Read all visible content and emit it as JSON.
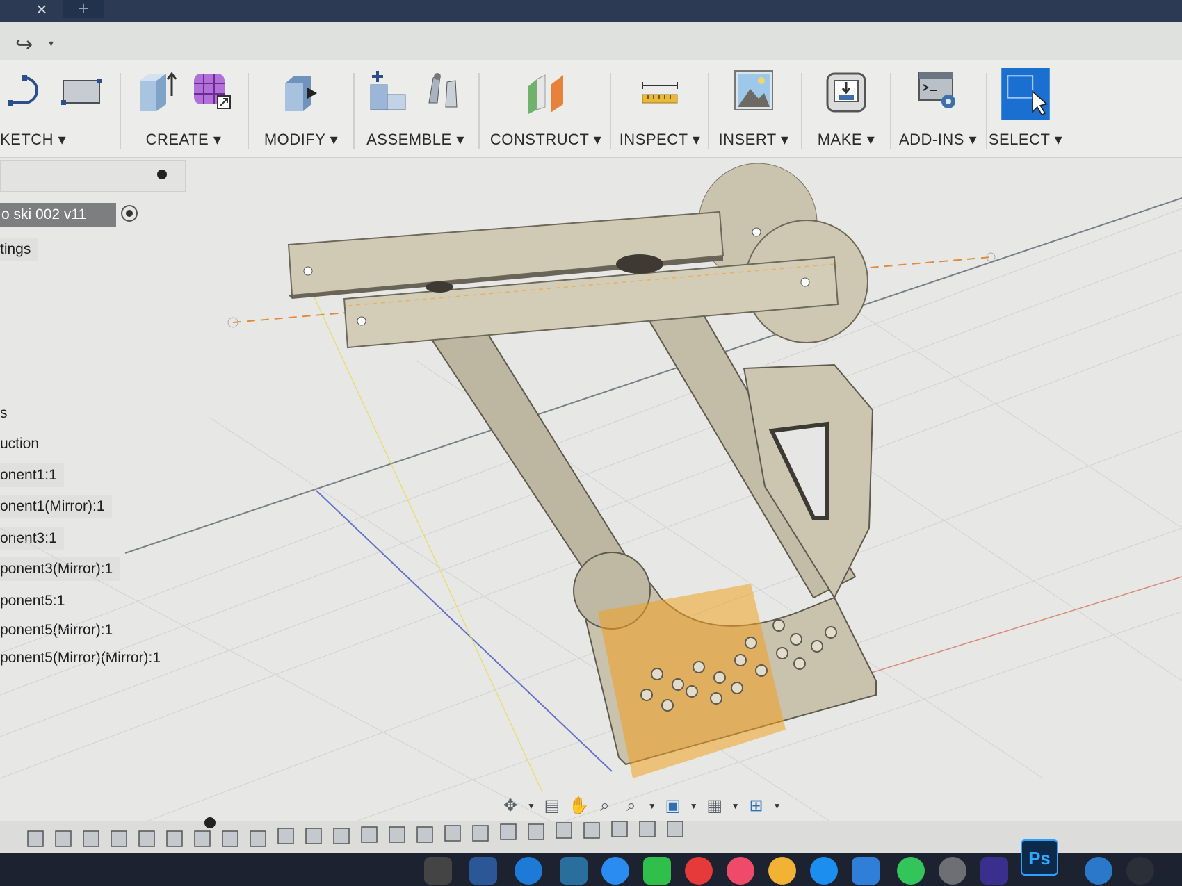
{
  "window": {
    "close_glyph": "×",
    "new_tab_glyph": "+"
  },
  "quickbar": {
    "redo_glyph": "↪",
    "redo_icon": "redo-icon",
    "caret": "▾"
  },
  "toolbar": {
    "groups": [
      {
        "id": "sketch",
        "label": "KETCH ▾",
        "icons": [
          "arc-sketch-icon",
          "rectangle-sketch-icon"
        ]
      },
      {
        "id": "create",
        "label": "CREATE ▾",
        "icons": [
          "extrude-box-icon",
          "form-cage-icon"
        ]
      },
      {
        "id": "modify",
        "label": "MODIFY ▾",
        "icons": [
          "press-pull-icon"
        ]
      },
      {
        "id": "assemble",
        "label": "ASSEMBLE ▾",
        "icons": [
          "new-component-icon",
          "joint-icon"
        ]
      },
      {
        "id": "construct",
        "label": "CONSTRUCT ▾",
        "icons": [
          "offset-plane-icon"
        ]
      },
      {
        "id": "inspect",
        "label": "INSPECT ▾",
        "icons": [
          "measure-icon"
        ]
      },
      {
        "id": "insert",
        "label": "INSERT ▾",
        "icons": [
          "insert-image-icon"
        ]
      },
      {
        "id": "make",
        "label": "MAKE ▾",
        "icons": [
          "3d-print-icon"
        ]
      },
      {
        "id": "addins",
        "label": "ADD-INS ▾",
        "icons": [
          "scripts-gear-icon"
        ]
      },
      {
        "id": "select",
        "label": "SELECT ▾",
        "icons": [
          "select-cursor-icon"
        ]
      }
    ],
    "accent": "#1a6fd1"
  },
  "browser": {
    "document_name": "o ski 002 v11",
    "items": [
      {
        "label": "tings"
      },
      {
        "label": "s"
      },
      {
        "label": "uction"
      },
      {
        "label": "onent1:1"
      },
      {
        "label": "onent1(Mirror):1"
      },
      {
        "label": "onent3:1"
      },
      {
        "label": "ponent3(Mirror):1"
      },
      {
        "label": "ponent5:1"
      },
      {
        "label": "ponent5(Mirror):1"
      },
      {
        "label": "ponent5(Mirror)(Mirror):1"
      }
    ]
  },
  "navbar": {
    "icons": [
      "orbit-icon",
      "look-at-icon",
      "pan-hand-icon",
      "zoom-icon",
      "zoom-window-icon",
      "display-settings-icon",
      "grid-icon",
      "viewports-icon"
    ]
  },
  "dock": {
    "ps_label": "Ps",
    "icons": [
      "finder-icon",
      "word-icon",
      "onedrive-icon",
      "messages-icon",
      "facetime-icon",
      "news-icon",
      "music-icon",
      "photos-icon",
      "app-store-icon",
      "keynote-icon",
      "whatsapp-icon",
      "system-preferences-icon",
      "imovie-icon",
      "photoshop-icon",
      "safari-icon",
      "quicktime-icon"
    ]
  },
  "model": {
    "part_color": "#cfc8b2",
    "highlight_color": "#f0a020"
  }
}
